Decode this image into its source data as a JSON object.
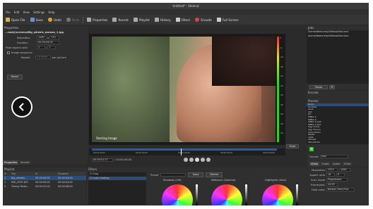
{
  "window_title": "Untitled* - Shotcut",
  "menu": [
    "File",
    "Edit",
    "View",
    "Settings",
    "Help"
  ],
  "toolbar": {
    "open": "Open File",
    "save": "Save",
    "undo": "Undo",
    "redo": "Redo",
    "properties": "Properties",
    "recent": "Recent",
    "playlist": "Playlist",
    "history": "History",
    "filters": "Filters",
    "encode": "Encode",
    "fullscreen": "Full Screen"
  },
  "properties": {
    "title": "Properties",
    "filename": "...nody/screens/Big_wheels_woman_1.jpg",
    "resolution_label": "Resolution",
    "res_w": "1280",
    "res_x": "x",
    "res_h": "720",
    "duration_label": "Duration",
    "duration": "00:00:04:00",
    "pixel_aspect_label": "Pixel aspect ratio",
    "par_w": "1",
    "par_c": ":",
    "par_h": "1",
    "image_seq_label": "Image sequence",
    "repeat_label": "Repeat",
    "repeat_val": "1 frames",
    "per_picture": "per picture",
    "reset": "Reset"
  },
  "left_tabs": [
    "Properties",
    "Recent"
  ],
  "playlist": {
    "title": "Playlist",
    "headers": [
      "#",
      "Clip",
      "In",
      "Duration"
    ],
    "rows": [
      {
        "n": "1",
        "clip": "Big_wheels...",
        "in": "00:00:00:00",
        "dur": "00:00:04:00"
      },
      {
        "n": "2",
        "clip": "IMG_0997.JPG",
        "in": "00:00:00:00",
        "dur": "00:00:04:00"
      },
      {
        "n": "3",
        "clip": "Timing Testin...",
        "in": "00:00:47:00",
        "dur": "00:00:48:00"
      }
    ]
  },
  "player": {
    "overlay": "Starting Image",
    "meter": [
      "0",
      "-5",
      "-10",
      "-15",
      "-20",
      "-25",
      "-30",
      "-35",
      "-40",
      "-45",
      "-50"
    ],
    "mute": "Mute",
    "timecode": "00:00:01:17",
    "total": "/ 00:00:06:00",
    "ruler": [
      "00:00:00:00",
      "00:00:00:00",
      "00:00:00:00",
      "00:00:00:00",
      "00:00:00:00"
    ]
  },
  "jobs": {
    "title": "Jobs",
    "items": [
      "/home/ddennedy/Videos/test.mov",
      "/home/ddennedy/Videos/test.mov"
    ],
    "pause": "Pause"
  },
  "encode": {
    "title": "Encode",
    "presets_label": "Presets",
    "presets": [
      "Stock",
      "YouTube",
      "ALAC",
      "AVC",
      "DV",
      "MPEG-2",
      "MPEG-4",
      "MPEG-4-ASP",
      "MPEG-4-AVC",
      "Ogg Vorbis",
      "Ogg Theora",
      "Slow Motion",
      "WebM",
      "x264",
      "XDCAM",
      "XDCAM-HD"
    ],
    "format_label": "Format",
    "format": "mov",
    "tabs": [
      "Video",
      "Codec",
      "Audio",
      "Other"
    ],
    "resolution_label": "Resolution",
    "res_w": "1920",
    "res_h": "1080",
    "aspect_label": "Aspect ratio",
    "asp_w": "16",
    "asp_h": "9",
    "scan_label": "Scan mode",
    "scan": "Progressive",
    "fps_label": "Frames/sec",
    "fps": "24.00",
    "field_label": "Field order",
    "field": "Bottom Field First"
  },
  "filters": {
    "title": "Filters",
    "items": [
      {
        "name": "Crop",
        "checked": true
      },
      {
        "name": "Color Grading",
        "checked": true
      }
    ],
    "preset_label": "Preset",
    "save": "Save",
    "delete": "Delete",
    "wheels": [
      "Shadows (Lift)",
      "Midtones (Gamma)",
      "Highlights (Gain)"
    ]
  },
  "colors": {
    "accent": "#2a4d7a",
    "timeline": "#1f5fa8",
    "bg": "#2b2b2b"
  }
}
